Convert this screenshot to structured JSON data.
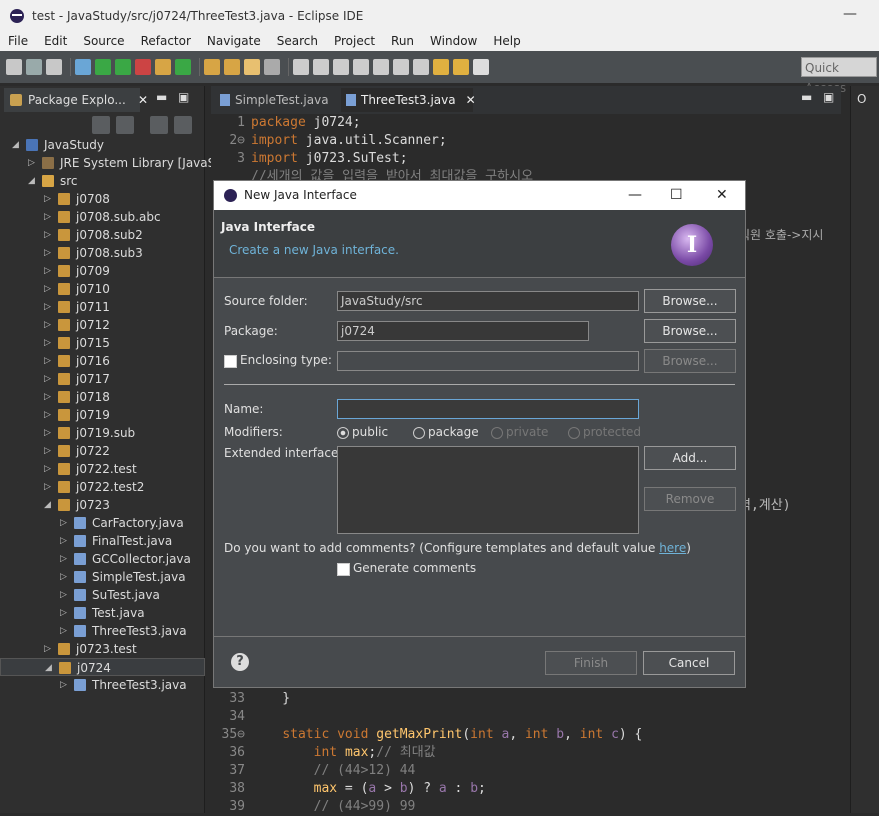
{
  "window": {
    "title": "test - JavaStudy/src/j0724/ThreeTest3.java - Eclipse IDE",
    "min": "—"
  },
  "menu": [
    "File",
    "Edit",
    "Source",
    "Refactor",
    "Navigate",
    "Search",
    "Project",
    "Run",
    "Window",
    "Help"
  ],
  "quick_access": "Quick Access",
  "explorer": {
    "tab": "Package Explo...",
    "items": [
      {
        "label": "JavaStudy",
        "indent": 0,
        "arrow": "◢",
        "type": "prj"
      },
      {
        "label": "JRE System Library [JavaS",
        "indent": 1,
        "arrow": "▷",
        "type": "lib"
      },
      {
        "label": "src",
        "indent": 1,
        "arrow": "◢",
        "type": "fld"
      },
      {
        "label": "j0708",
        "indent": 2,
        "arrow": "▷",
        "type": "pkg"
      },
      {
        "label": "j0708.sub.abc",
        "indent": 2,
        "arrow": "▷",
        "type": "pkg"
      },
      {
        "label": "j0708.sub2",
        "indent": 2,
        "arrow": "▷",
        "type": "pkg"
      },
      {
        "label": "j0708.sub3",
        "indent": 2,
        "arrow": "▷",
        "type": "pkg"
      },
      {
        "label": "j0709",
        "indent": 2,
        "arrow": "▷",
        "type": "pkg"
      },
      {
        "label": "j0710",
        "indent": 2,
        "arrow": "▷",
        "type": "pkg"
      },
      {
        "label": "j0711",
        "indent": 2,
        "arrow": "▷",
        "type": "pkg"
      },
      {
        "label": "j0712",
        "indent": 2,
        "arrow": "▷",
        "type": "pkg"
      },
      {
        "label": "j0715",
        "indent": 2,
        "arrow": "▷",
        "type": "pkg"
      },
      {
        "label": "j0716",
        "indent": 2,
        "arrow": "▷",
        "type": "pkg"
      },
      {
        "label": "j0717",
        "indent": 2,
        "arrow": "▷",
        "type": "pkg"
      },
      {
        "label": "j0718",
        "indent": 2,
        "arrow": "▷",
        "type": "pkg"
      },
      {
        "label": "j0719",
        "indent": 2,
        "arrow": "▷",
        "type": "pkg"
      },
      {
        "label": "j0719.sub",
        "indent": 2,
        "arrow": "▷",
        "type": "pkg"
      },
      {
        "label": "j0722",
        "indent": 2,
        "arrow": "▷",
        "type": "pkg"
      },
      {
        "label": "j0722.test",
        "indent": 2,
        "arrow": "▷",
        "type": "pkg"
      },
      {
        "label": "j0722.test2",
        "indent": 2,
        "arrow": "▷",
        "type": "pkg"
      },
      {
        "label": "j0723",
        "indent": 2,
        "arrow": "◢",
        "type": "pkg"
      },
      {
        "label": "CarFactory.java",
        "indent": 3,
        "arrow": "▷",
        "type": "jfile"
      },
      {
        "label": "FinalTest.java",
        "indent": 3,
        "arrow": "▷",
        "type": "jfile"
      },
      {
        "label": "GCCollector.java",
        "indent": 3,
        "arrow": "▷",
        "type": "jfile"
      },
      {
        "label": "SimpleTest.java",
        "indent": 3,
        "arrow": "▷",
        "type": "jfile"
      },
      {
        "label": "SuTest.java",
        "indent": 3,
        "arrow": "▷",
        "type": "jfile"
      },
      {
        "label": "Test.java",
        "indent": 3,
        "arrow": "▷",
        "type": "jfile"
      },
      {
        "label": "ThreeTest3.java",
        "indent": 3,
        "arrow": "▷",
        "type": "jfile"
      },
      {
        "label": "j0723.test",
        "indent": 2,
        "arrow": "▷",
        "type": "pkg"
      },
      {
        "label": "j0724",
        "indent": 2,
        "arrow": "◢",
        "type": "pkg",
        "selected": true
      },
      {
        "label": "ThreeTest3.java",
        "indent": 3,
        "arrow": "▷",
        "type": "jfile"
      }
    ]
  },
  "editor": {
    "tabs": [
      {
        "label": "SimpleTest.java"
      },
      {
        "label": "ThreeTest3.java",
        "active": true
      }
    ],
    "top_lines": [
      {
        "n": "1",
        "html": "<span class='kw'>package</span> j0724;"
      },
      {
        "n": "2⊖",
        "html": "<span class='kw'>import</span> java.util.Scanner;"
      },
      {
        "n": "3",
        "html": "<span class='kw'>import</span> j0723.SuTest;"
      },
      {
        "n": "",
        "html": "<span class='cm'>//세개의 값을 입력을 받아서 최대값을 구하시오</span>"
      }
    ],
    "bottom_lines": [
      {
        "n": "33",
        "html": "    }"
      },
      {
        "n": "34",
        "html": ""
      },
      {
        "n": "35⊖",
        "html": "    <span class='kw'>static</span> <span class='kw'>void</span> <span class='fn'>getMaxPrint</span>(<span class='kw'>int</span> <span class='var'>a</span>, <span class='kw'>int</span> <span class='var'>b</span>, <span class='kw'>int</span> <span class='var'>c</span>) {"
      },
      {
        "n": "36",
        "html": "        <span class='kw'>int</span> <span class='fn'>max</span>;<span class='cm'>// 최대값</span>"
      },
      {
        "n": "37",
        "html": "        <span class='cm'>// (44>12) 44</span>"
      },
      {
        "n": "38",
        "html": "        <span class='fn'>max</span> = (<span class='var'>a</span> > <span class='var'>b</span>) ? <span class='var'>a</span> : <span class='var'>b</span>;"
      },
      {
        "n": "39",
        "html": "        <span class='cm'>// (44>99) 99</span>"
      }
    ],
    "side_text_1": "직원 호출->지시",
    "side_text_2": "력,계산)"
  },
  "dialog": {
    "title": "New Java Interface",
    "heading": "Java Interface",
    "subheading": "Create a new Java interface.",
    "badge": "I",
    "source_folder_label": "Source folder:",
    "source_folder": "JavaStudy/src",
    "package_label": "Package:",
    "package": "j0724",
    "enclosing_label": "Enclosing type:",
    "browse": "Browse...",
    "name_label": "Name:",
    "name_value": "",
    "modifiers_label": "Modifiers:",
    "mod_public": "public",
    "mod_package": "package",
    "mod_private": "private",
    "mod_protected": "protected",
    "ext_label": "Extended interfaces:",
    "add": "Add...",
    "remove": "Remove",
    "comments_q": "Do you want to add comments? (Configure templates and default value ",
    "here": "here",
    "comments_end": ")",
    "gen_comments": "Generate comments",
    "finish": "Finish",
    "cancel": "Cancel",
    "help": "?",
    "ctl_min": "—",
    "ctl_max": "☐",
    "ctl_close": "✕"
  }
}
